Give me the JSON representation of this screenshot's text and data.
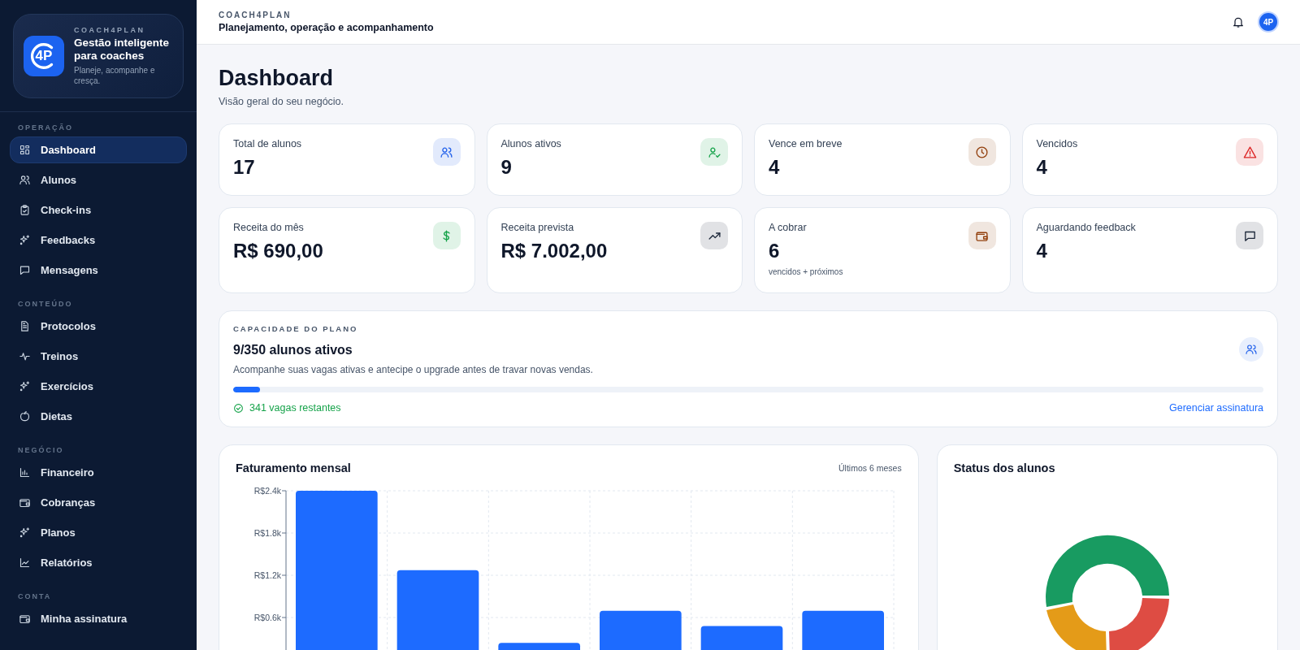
{
  "sidebar": {
    "brand": {
      "logo_text": "4P",
      "eyebrow": "COACH4PLAN",
      "title": "Gestão inteligente para coaches",
      "tagline": "Planeje, acompanhe e cresça."
    },
    "groups": [
      {
        "label": "OPERAÇÃO",
        "items": [
          {
            "label": "Dashboard",
            "selected": true
          },
          {
            "label": "Alunos",
            "selected": false
          },
          {
            "label": "Check-ins",
            "selected": false
          },
          {
            "label": "Feedbacks",
            "selected": false
          },
          {
            "label": "Mensagens",
            "selected": false
          }
        ]
      },
      {
        "label": "CONTEÚDO",
        "items": [
          {
            "label": "Protocolos",
            "selected": false
          },
          {
            "label": "Treinos",
            "selected": false
          },
          {
            "label": "Exercícios",
            "selected": false
          },
          {
            "label": "Dietas",
            "selected": false
          }
        ]
      },
      {
        "label": "NEGÓCIO",
        "items": [
          {
            "label": "Financeiro",
            "selected": false
          },
          {
            "label": "Cobranças",
            "selected": false
          },
          {
            "label": "Planos",
            "selected": false
          },
          {
            "label": "Relatórios",
            "selected": false
          }
        ]
      },
      {
        "label": "CONTA",
        "items": [
          {
            "label": "Minha assinatura",
            "selected": false
          }
        ]
      }
    ]
  },
  "header": {
    "brand": "COACH4PLAN",
    "subtitle": "Planejamento, operação e acompanhamento",
    "avatar_text": "4P"
  },
  "page": {
    "title": "Dashboard",
    "subtitle": "Visão geral do seu negócio."
  },
  "stats": [
    {
      "label": "Total de alunos",
      "value": "17",
      "color": "#2563eb"
    },
    {
      "label": "Alunos ativos",
      "value": "9",
      "color": "#16a34a"
    },
    {
      "label": "Vence em breve",
      "value": "4",
      "color": "#92400e"
    },
    {
      "label": "Vencidos",
      "value": "4",
      "color": "#dc2626"
    },
    {
      "label": "Receita do mês",
      "value": "R$ 690,00",
      "color": "#16a34a"
    },
    {
      "label": "Receita prevista",
      "value": "R$ 7.002,00",
      "color": "#1e293b"
    },
    {
      "label": "A cobrar",
      "value": "6",
      "note": "vencidos + próximos",
      "color": "#92400e"
    },
    {
      "label": "Aguardando feedback",
      "value": "4",
      "color": "#1e293b"
    }
  ],
  "capacity": {
    "eyebrow": "CAPACIDADE DO PLANO",
    "title": "9/350 alunos ativos",
    "description": "Acompanhe suas vagas ativas e antecipe o upgrade antes de travar novas vendas.",
    "level": 0.026,
    "remaining": "341 vagas restantes",
    "link": "Gerenciar assinatura"
  },
  "revenue": {
    "title": "Faturamento mensal",
    "period": "Últimos 6 meses",
    "axis_labels": [
      "R$2.4k",
      "R$1.8k",
      "R$1.2k",
      "R$0.6k"
    ]
  },
  "status": {
    "title": "Status dos alunos"
  }
}
